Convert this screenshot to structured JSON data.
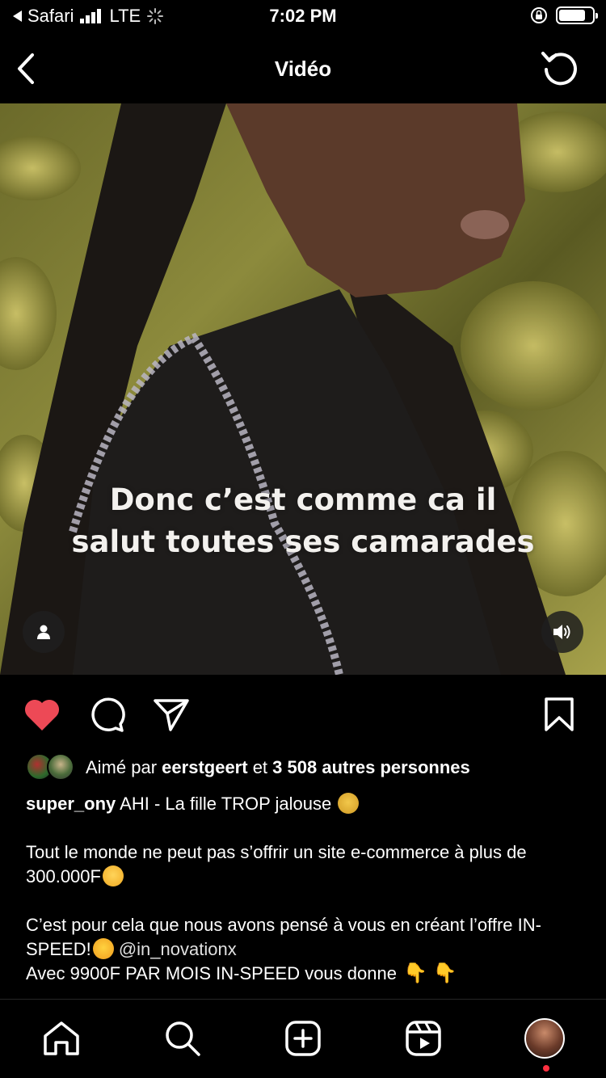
{
  "status_bar": {
    "back_app": "Safari",
    "network": "LTE",
    "time": "7:02 PM"
  },
  "nav": {
    "title": "Vidéo",
    "back_icon": "chevron-left-icon",
    "refresh_icon": "refresh-icon"
  },
  "video": {
    "caption_line1": "Donc c’est comme ca il",
    "caption_line2": "salut toutes ses camarades"
  },
  "actions": {
    "like_color": "#ed4956",
    "icons": [
      "heart-icon",
      "comment-icon",
      "share-icon",
      "bookmark-icon"
    ]
  },
  "post": {
    "likes_prefix": "Aimé par",
    "likes_user": "eerstgeert",
    "likes_and": "et",
    "likes_others": "3 508 autres personnes",
    "author": "super_ony",
    "caption_line1": "AHI - La fille TROP jalouse",
    "paragraph2": "Tout le monde ne peut pas s’offrir un site e-commerce à plus de 300.000F",
    "paragraph3_a": "C’est pour cela que nous avons pensé à vous en créant l’offre IN-SPEED!",
    "mention": "@in_novationx",
    "paragraph3_b": "Avec 9900F PAR MOIS IN-SPEED vous donne"
  },
  "tabbar": {
    "icons": [
      "home-icon",
      "search-icon",
      "new-post-icon",
      "reels-icon",
      "profile-avatar"
    ]
  }
}
